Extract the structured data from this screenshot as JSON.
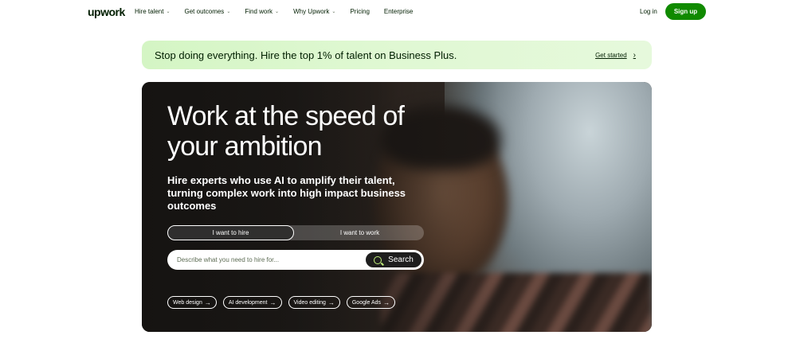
{
  "nav": {
    "logo": "upwork",
    "links": [
      {
        "label": "Hire talent",
        "dropdown": true
      },
      {
        "label": "Get outcomes",
        "dropdown": true
      },
      {
        "label": "Find work",
        "dropdown": true
      },
      {
        "label": "Why Upwork",
        "dropdown": true
      },
      {
        "label": "Pricing",
        "dropdown": false
      },
      {
        "label": "Enterprise",
        "dropdown": false
      }
    ],
    "login": "Log in",
    "signup": "Sign up"
  },
  "banner": {
    "text": "Stop doing everything. Hire the top 1% of talent on Business Plus.",
    "link": "Get started"
  },
  "hero": {
    "title": "Work at the speed of your ambition",
    "subtitle": "Hire experts who use AI to amplify their talent, turning complex work into high impact business outcomes",
    "toggle": {
      "active": "I want to hire",
      "inactive": "I want to work"
    },
    "search": {
      "placeholder": "Describe what you need to hire for...",
      "button": "Search"
    },
    "chips": [
      "Web design",
      "AI development",
      "Video editing",
      "Google Ads"
    ]
  },
  "colors": {
    "brand_green": "#108a00",
    "banner_bg": "#d4f5c4",
    "text": "#001e00",
    "search_icon": "#c2f07c"
  },
  "icons": [
    "chevron-down-icon",
    "chevron-right-icon",
    "search-icon",
    "arrow-right-icon"
  ]
}
